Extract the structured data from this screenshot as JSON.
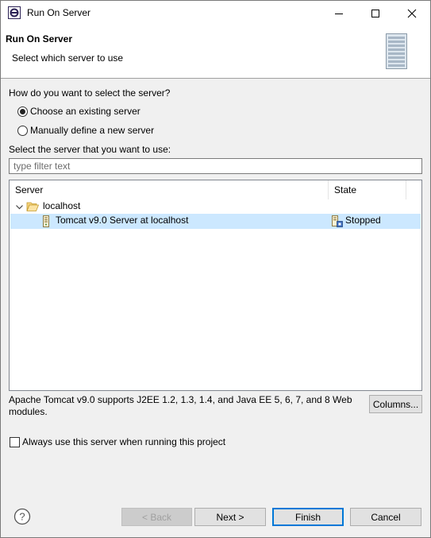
{
  "window": {
    "title": "Run On Server"
  },
  "header": {
    "title": "Run On Server",
    "description": "Select which server to use"
  },
  "selection": {
    "question": "How do you want to select the server?",
    "option_existing": "Choose an existing server",
    "option_existing_checked": true,
    "option_new": "Manually define a new server",
    "option_new_checked": false,
    "select_label": "Select the server that you want to use:"
  },
  "filter": {
    "placeholder": "type filter text",
    "value": ""
  },
  "table": {
    "columns": [
      "Server",
      "State"
    ],
    "groups": [
      {
        "label": "localhost",
        "expanded": true,
        "rows": [
          {
            "server": "Tomcat v9.0 Server at localhost",
            "state": "Stopped",
            "selected": true
          }
        ]
      }
    ]
  },
  "info": {
    "text": "Apache Tomcat v9.0 supports J2EE 1.2, 1.3, 1.4, and Java EE 5, 6, 7, and 8 Web modules.",
    "columns_button": "Columns..."
  },
  "always_use": {
    "label": "Always use this server when running this project",
    "checked": false
  },
  "buttons": {
    "back": "< Back",
    "next": "Next >",
    "finish": "Finish",
    "cancel": "Cancel"
  },
  "colors": {
    "selection": "#cce8ff",
    "default_button_border": "#0078d7",
    "dialog_bg": "#f0f0f0"
  },
  "icons": {
    "app": "eclipse-icon",
    "header": "server-icon",
    "folder": "folder-open-icon",
    "server": "tomcat-server-icon",
    "state": "stopped-state-icon",
    "help": "help-icon"
  }
}
